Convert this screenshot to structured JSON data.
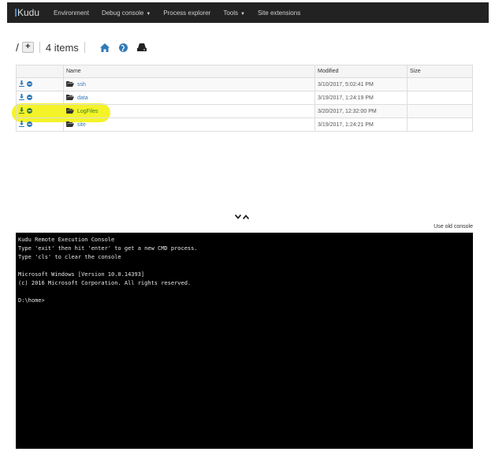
{
  "navbar": {
    "brand": "Kudu",
    "items": [
      {
        "label": "Environment",
        "dropdown": false
      },
      {
        "label": "Debug console",
        "dropdown": true
      },
      {
        "label": "Process explorer",
        "dropdown": false
      },
      {
        "label": "Tools",
        "dropdown": true
      },
      {
        "label": "Site extensions",
        "dropdown": false
      }
    ]
  },
  "toolbar": {
    "path": "/",
    "add_label": "+",
    "item_count": "4 items"
  },
  "table": {
    "headers": [
      "Name",
      "Modified",
      "Size"
    ],
    "rows": [
      {
        "name": "ssh",
        "modified": "3/10/2017, 5:02:41 PM",
        "size": ""
      },
      {
        "name": "data",
        "modified": "3/19/2017, 1:24:19 PM",
        "size": ""
      },
      {
        "name": "LogFiles",
        "modified": "3/20/2017, 12:32:00 PM",
        "size": ""
      },
      {
        "name": "site",
        "modified": "3/19/2017, 1:24:21 PM",
        "size": ""
      }
    ]
  },
  "console": {
    "old_console_link": "Use old console",
    "lines": [
      "Kudu Remote Execution Console",
      "Type 'exit' then hit 'enter' to get a new CMD process.",
      "Type 'cls' to clear the console",
      "",
      "Microsoft Windows [Version 10.0.14393]",
      "(c) 2016 Microsoft Corporation. All rights reserved.",
      "",
      "D:\\home>"
    ]
  },
  "colors": {
    "navbar_bg": "#222222",
    "link": "#337ab7",
    "highlight": "#f3f21c",
    "console_bg": "#000000"
  }
}
